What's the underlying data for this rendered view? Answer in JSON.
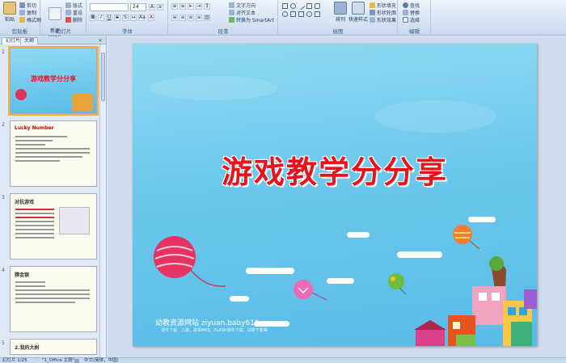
{
  "ribbon": {
    "clipboard": {
      "paste": "粘贴",
      "cut": "剪切",
      "copy": "复制",
      "format_painter": "格式刷",
      "label": "剪贴板"
    },
    "slides": {
      "new_slide": "新建\n幻灯片",
      "layout": "版式",
      "reset": "重设",
      "delete": "删除",
      "label": "幻灯片"
    },
    "font": {
      "size": "24",
      "label": "字体"
    },
    "paragraph": {
      "text_direction": "文字方向",
      "align_text": "对齐文本",
      "smartart": "转换为 SmartArt",
      "label": "段落"
    },
    "drawing": {
      "arrange": "排列",
      "quick_styles": "快速样式",
      "shape_fill": "形状填充",
      "shape_outline": "形状轮廓",
      "shape_effects": "形状效果",
      "label": "绘图"
    },
    "editing": {
      "find": "查找",
      "replace": "替换",
      "select": "选择",
      "label": "编辑"
    }
  },
  "panel": {
    "tabs": [
      "幻灯片",
      "大纲"
    ],
    "close": "×",
    "thumbnails": [
      {
        "number": "1",
        "title": "游戏教学分分享"
      },
      {
        "number": "2",
        "title": "Lucky Number"
      },
      {
        "number": "3",
        "title": "对抗游戏"
      },
      {
        "number": "4",
        "title": "猜金银"
      },
      {
        "number": "5",
        "title": "2.我的大树"
      }
    ]
  },
  "slide": {
    "title": "游戏教学分分享",
    "website": "幼教资源网站  ziyuan.baby611.com",
    "website_sub": "课件下载、儿歌、故事MP3、FLASH课件下载、试卷下载等"
  },
  "status": {
    "slide_info": "幻灯片 1/25",
    "theme": "\"1_Office 主题\"",
    "language": "中文(简体，中国)"
  },
  "colors": {
    "title_red": "#e8141d",
    "sky_blue": "#6cc8ec",
    "ribbon_blue": "#d7e4f3",
    "selection_orange": "#f7b13a"
  }
}
